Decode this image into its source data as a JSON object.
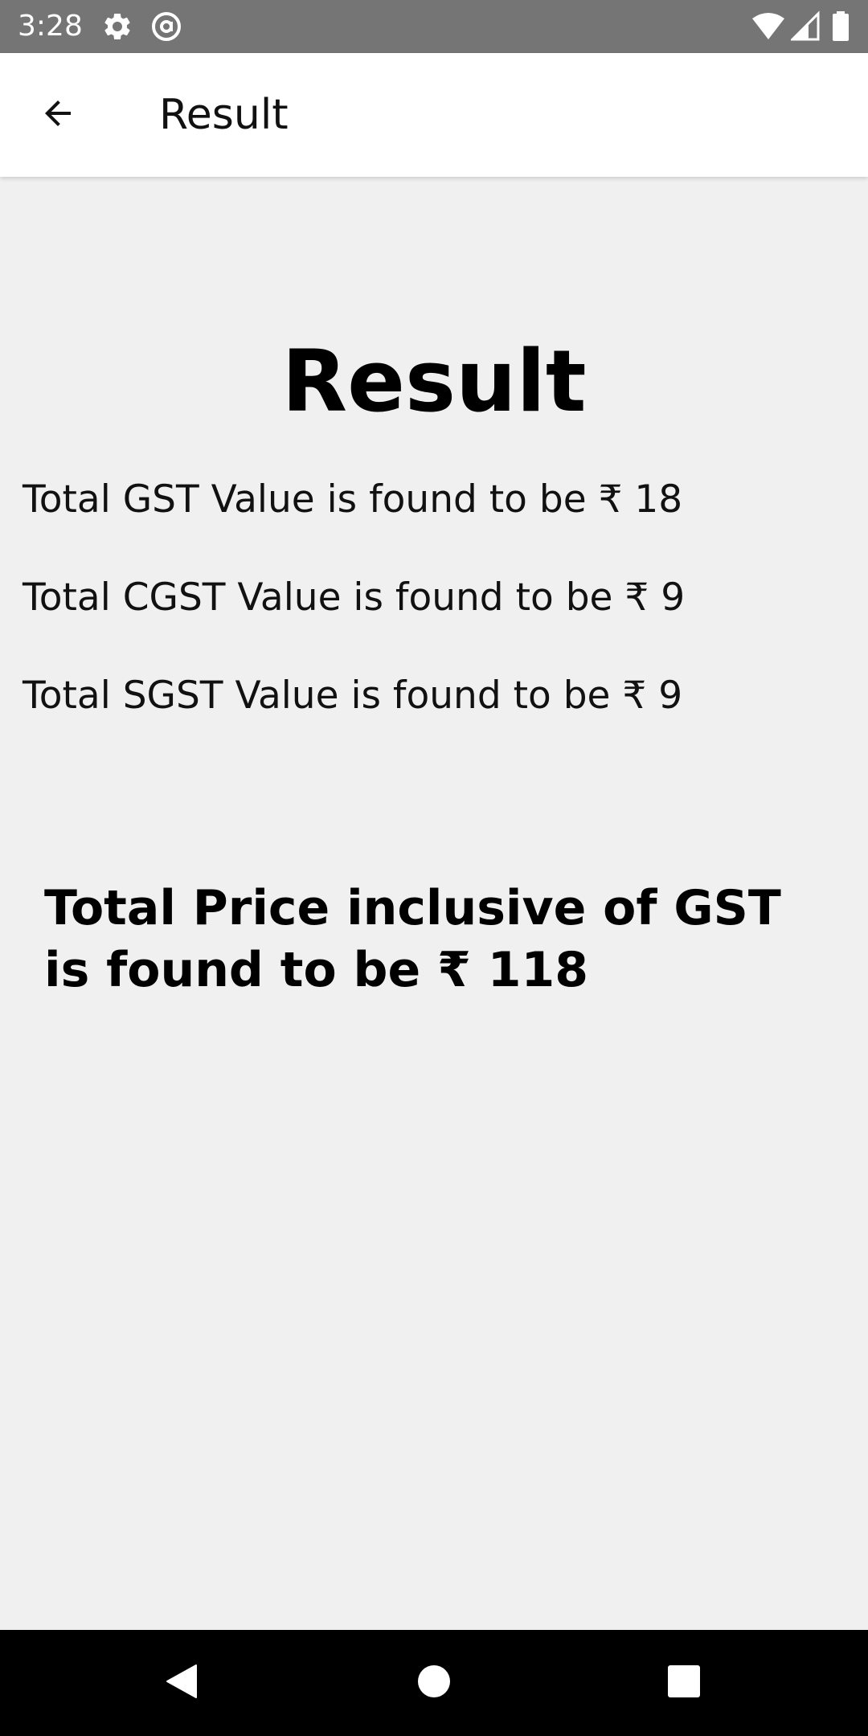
{
  "status_bar": {
    "time": "3:28",
    "icons": [
      "gear-icon",
      "at-sign-icon",
      "wifi-icon",
      "signal-icon",
      "battery-icon"
    ]
  },
  "app_bar": {
    "title": "Result",
    "back_icon": "arrow-left-icon"
  },
  "content": {
    "heading": "Result",
    "lines": [
      "Total GST Value is found to be ₹ 18",
      "Total CGST Value is found to be ₹ 9",
      "Total SGST Value is found to be ₹ 9"
    ],
    "total_price": "Total Price inclusive of GST is found to be ₹ 118"
  },
  "nav_bar": {
    "icons": [
      "back-triangle-icon",
      "home-circle-icon",
      "recents-square-icon"
    ]
  },
  "colors": {
    "status_bar": "#757575",
    "app_bar": "#ffffff",
    "background": "#f0f0f0",
    "nav_bar": "#000000"
  }
}
